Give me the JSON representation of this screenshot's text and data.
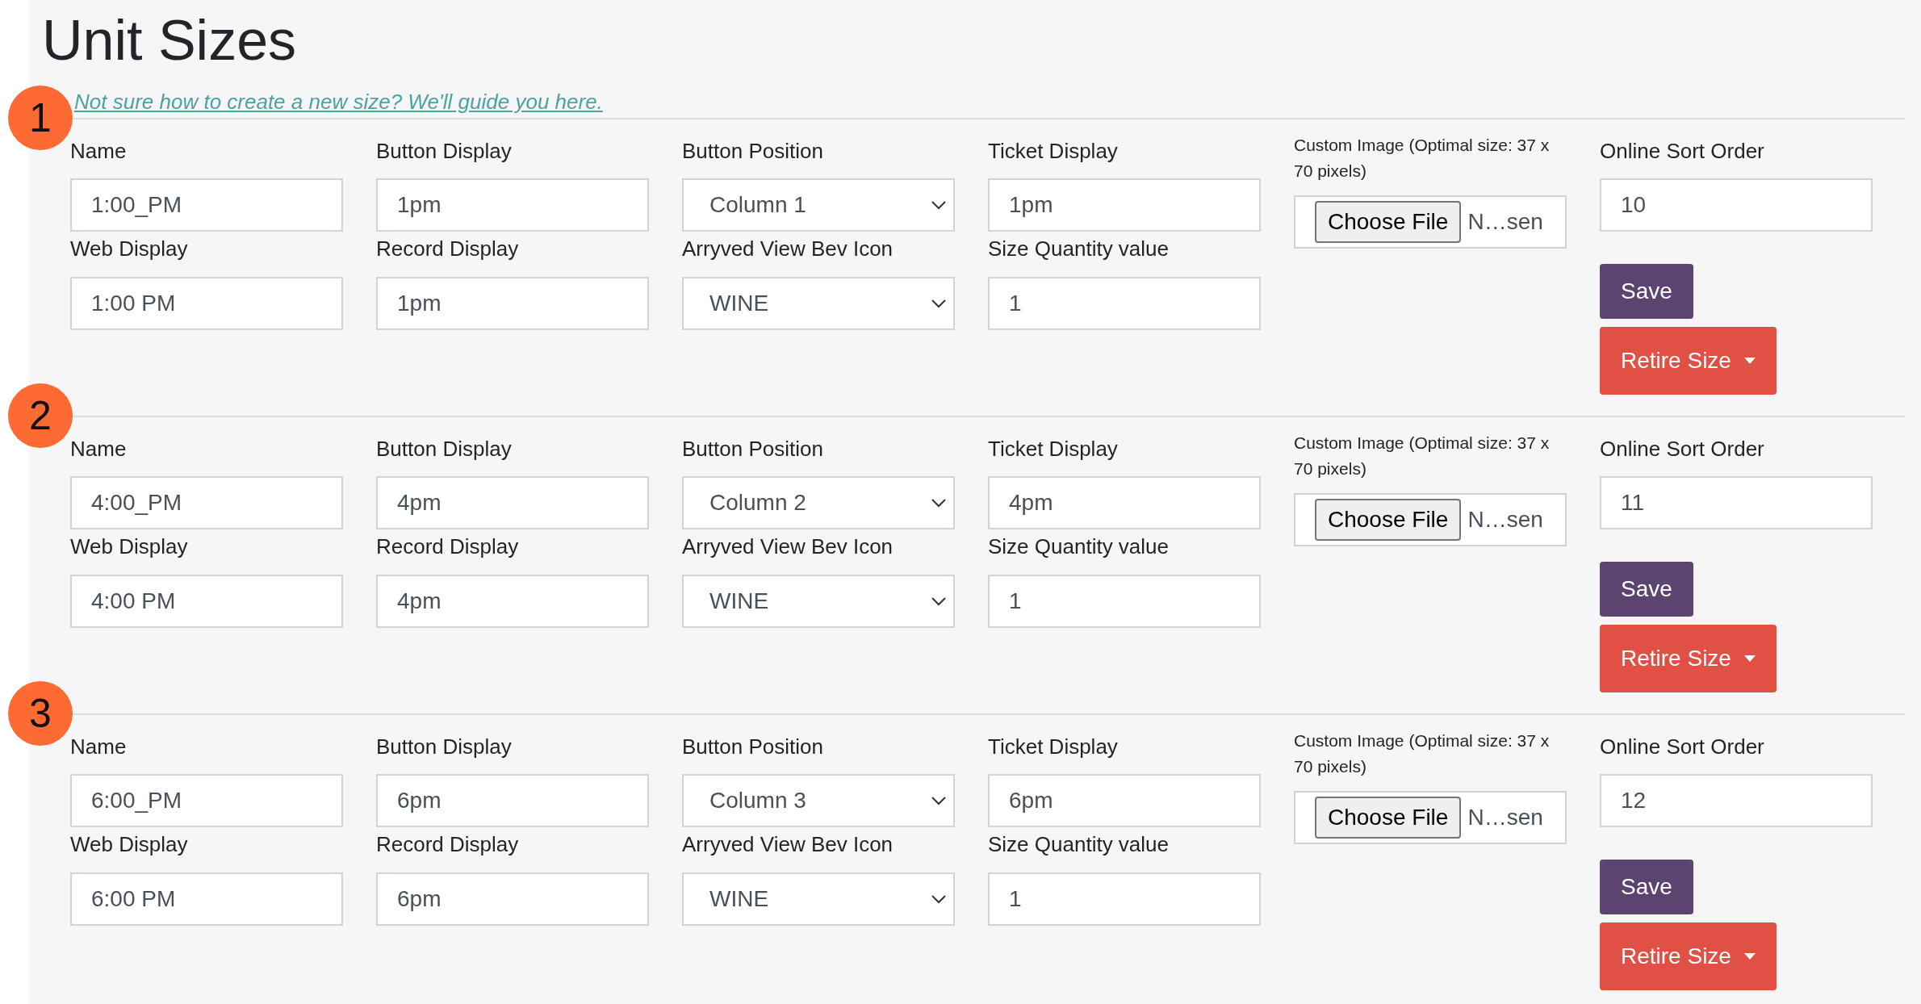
{
  "page": {
    "title": "Unit Sizes"
  },
  "help_link": "Not sure how to create a new size? We'll guide you here.",
  "units": [
    {
      "badge": "1",
      "fields": [
        {
          "label": "Name",
          "value": "1:00_PM",
          "kind": "text"
        },
        {
          "label": "Button Display",
          "value": "1pm",
          "kind": "text"
        },
        {
          "label": "Button Position",
          "value": "Column 1",
          "kind": "select"
        },
        {
          "label": "Ticket Display",
          "value": "1pm",
          "kind": "text"
        },
        {
          "label": "Web Display",
          "value": "1:00 PM",
          "kind": "text"
        },
        {
          "label": "Record Display",
          "value": "1pm",
          "kind": "text"
        },
        {
          "label": "Arryved View Bev Icon",
          "value": "WINE",
          "kind": "select"
        },
        {
          "label": "Size Quantity value",
          "value": "1",
          "kind": "text"
        }
      ],
      "custom_image": {
        "label": "Custom Image (Optimal size: 37 x 70 pixels)",
        "button": "Choose File",
        "file_name": "N…sen"
      },
      "sort_order": {
        "label": "Online Sort Order",
        "value": "10"
      },
      "save_button": "Save",
      "retire_button": "Retire Size"
    },
    {
      "badge": "2",
      "fields": [
        {
          "label": "Name",
          "value": "4:00_PM",
          "kind": "text"
        },
        {
          "label": "Button Display",
          "value": "4pm",
          "kind": "text"
        },
        {
          "label": "Button Position",
          "value": "Column 2",
          "kind": "select"
        },
        {
          "label": "Ticket Display",
          "value": "4pm",
          "kind": "text"
        },
        {
          "label": "Web Display",
          "value": "4:00 PM",
          "kind": "text"
        },
        {
          "label": "Record Display",
          "value": "4pm",
          "kind": "text"
        },
        {
          "label": "Arryved View Bev Icon",
          "value": "WINE",
          "kind": "select"
        },
        {
          "label": "Size Quantity value",
          "value": "1",
          "kind": "text"
        }
      ],
      "custom_image": {
        "label": "Custom Image (Optimal size: 37 x 70 pixels)",
        "button": "Choose File",
        "file_name": "N…sen"
      },
      "sort_order": {
        "label": "Online Sort Order",
        "value": "11"
      },
      "save_button": "Save",
      "retire_button": "Retire Size"
    },
    {
      "badge": "3",
      "fields": [
        {
          "label": "Name",
          "value": "6:00_PM",
          "kind": "text"
        },
        {
          "label": "Button Display",
          "value": "6pm",
          "kind": "text"
        },
        {
          "label": "Button Position",
          "value": "Column 3",
          "kind": "select"
        },
        {
          "label": "Ticket Display",
          "value": "6pm",
          "kind": "text"
        },
        {
          "label": "Web Display",
          "value": "6:00 PM",
          "kind": "text"
        },
        {
          "label": "Record Display",
          "value": "6pm",
          "kind": "text"
        },
        {
          "label": "Arryved View Bev Icon",
          "value": "WINE",
          "kind": "select"
        },
        {
          "label": "Size Quantity value",
          "value": "1",
          "kind": "text"
        }
      ],
      "custom_image": {
        "label": "Custom Image (Optimal size: 37 x 70 pixels)",
        "button": "Choose File",
        "file_name": "N…sen"
      },
      "sort_order": {
        "label": "Online Sort Order",
        "value": "12"
      },
      "save_button": "Save",
      "retire_button": "Retire Size"
    }
  ]
}
